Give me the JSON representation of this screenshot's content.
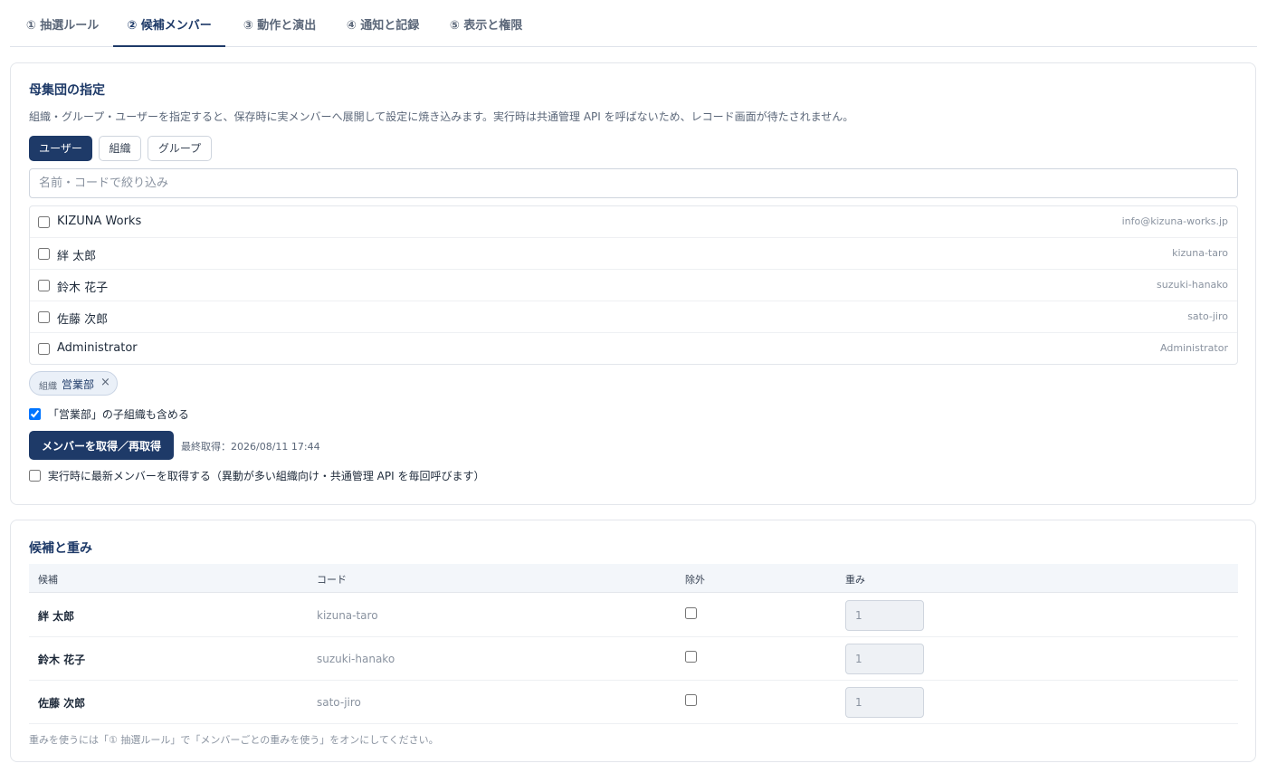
{
  "tabs": [
    {
      "label": "① 抽選ルール",
      "active": false
    },
    {
      "label": "② 候補メンバー",
      "active": true
    },
    {
      "label": "③ 動作と演出",
      "active": false
    },
    {
      "label": "④ 通知と記録",
      "active": false
    },
    {
      "label": "⑤ 表示と権限",
      "active": false
    }
  ],
  "population": {
    "title": "母集団の指定",
    "description": "組織・グループ・ユーザーを指定すると、保存時に実メンバーへ展開して設定に焼き込みます。実行時は共通管理 API を呼ばないため、レコード画面が待たされません。",
    "type_buttons": [
      {
        "label": "ユーザー",
        "active": true
      },
      {
        "label": "組織",
        "active": false
      },
      {
        "label": "グループ",
        "active": false
      }
    ],
    "filter_placeholder": "名前・コードで絞り込み",
    "filter_value": "",
    "members": [
      {
        "name": "KIZUNA Works",
        "code": "info@kizuna-works.jp",
        "checked": false
      },
      {
        "name": "絆 太郎",
        "code": "kizuna-taro",
        "checked": false
      },
      {
        "name": "鈴木 花子",
        "code": "suzuki-hanako",
        "checked": false
      },
      {
        "name": "佐藤 次郎",
        "code": "sato-jiro",
        "checked": false
      },
      {
        "name": "Administrator",
        "code": "Administrator",
        "checked": false
      }
    ],
    "chip": {
      "kind": "組織",
      "value": "営業部",
      "remove": "×"
    },
    "include_children": {
      "label": "「営業部」の子組織も含める",
      "checked": true
    },
    "fetch_button": "メンバーを取得／再取得",
    "last_fetched": "最終取得：2026/08/11 17:44",
    "runtime_fetch": {
      "label": "実行時に最新メンバーを取得する（異動が多い組織向け・共通管理 API を毎回呼びます）",
      "checked": false
    }
  },
  "candidates": {
    "title": "候補と重み",
    "headers": {
      "candidate": "候補",
      "code": "コード",
      "exclude": "除外",
      "weight": "重み"
    },
    "rows": [
      {
        "name": "絆 太郎",
        "code": "kizuna-taro",
        "excluded": false,
        "weight": "1"
      },
      {
        "name": "鈴木 花子",
        "code": "suzuki-hanako",
        "excluded": false,
        "weight": "1"
      },
      {
        "name": "佐藤 次郎",
        "code": "sato-jiro",
        "excluded": false,
        "weight": "1"
      }
    ],
    "note": "重みを使うには「① 抽選ルール」で「メンバーごとの重みを使う」をオンにしてください。"
  }
}
